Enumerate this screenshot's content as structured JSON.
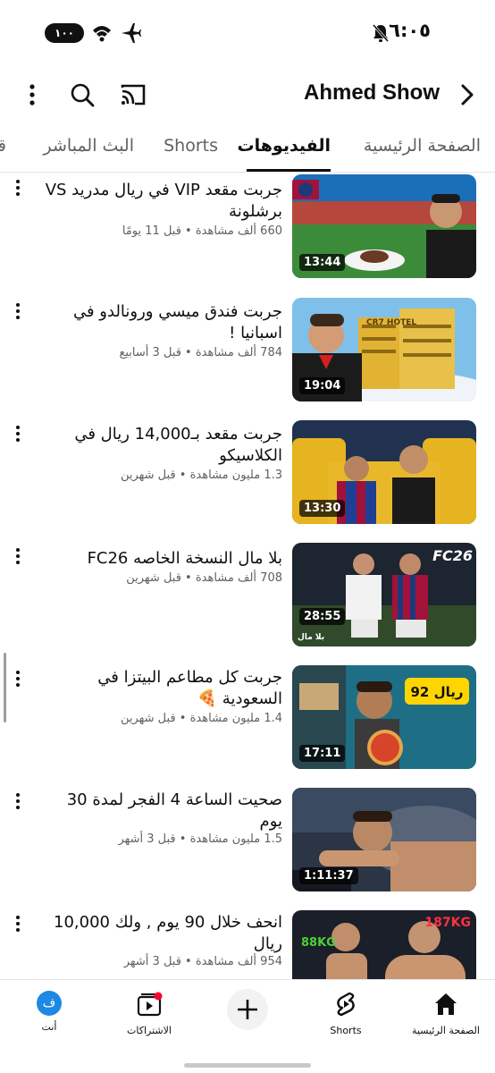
{
  "status_bar": {
    "time": "٦:٠٥",
    "battery": "١٠٠"
  },
  "header": {
    "channel_title": "Ahmed Show"
  },
  "tabs": [
    {
      "label": "الصفحة الرئيسية"
    },
    {
      "label": "الفيديوهات"
    },
    {
      "label": "Shorts"
    },
    {
      "label": "البث المباشر"
    },
    {
      "label": "قو"
    }
  ],
  "videos": [
    {
      "title": "جربت مقعد VIP في ريال مدريد VS برشلونة",
      "meta": "660 ألف مشاهدة • قبل 11 يومًا",
      "duration": "13:44"
    },
    {
      "title": "جربت فندق ميسي ورونالدو في اسبانيا !",
      "meta": "784 ألف مشاهدة • قبل 3 أسابيع",
      "duration": "19:04"
    },
    {
      "title": "جربت مقعد بـ14,000 ريال في الكلاسيكو",
      "meta": "1.3 مليون مشاهدة • قبل شهرين",
      "duration": "13:30"
    },
    {
      "title": "بلا مال النسخة الخاصه FC26",
      "meta": "708 ألف مشاهدة • قبل شهرين",
      "duration": "28:55"
    },
    {
      "title": "جربت كل مطاعم البيتزا في السعودية 🍕",
      "meta": "1.4 مليون مشاهدة • قبل شهرين",
      "duration": "17:11"
    },
    {
      "title": "صحيت الساعة 4 الفجر لمدة 30 يوم",
      "meta": "1.5 مليون مشاهدة • قبل 3 أشهر",
      "duration": "1:11:37"
    },
    {
      "title": "انحف خلال 90 يوم , ولك 10,000 ريال",
      "meta": "954 ألف مشاهدة • قبل 3 أشهر",
      "duration": ""
    }
  ],
  "thumb_text": {
    "cr7_hotel": "CR7 HOTEL",
    "fc26": "FC26",
    "fc26_watermark": "بلا مال",
    "pizza_price": "92 ريال",
    "weight_left": "88KG",
    "weight_right": "187KG"
  },
  "bottom_nav": {
    "home": "الصفحة الرئيسية",
    "shorts": "Shorts",
    "subscriptions": "الاشتراكات",
    "you": "أنت",
    "avatar_letter": "ف"
  },
  "colors": {
    "accent_red": "#ff0033",
    "avatar_blue": "#1e88e5"
  }
}
